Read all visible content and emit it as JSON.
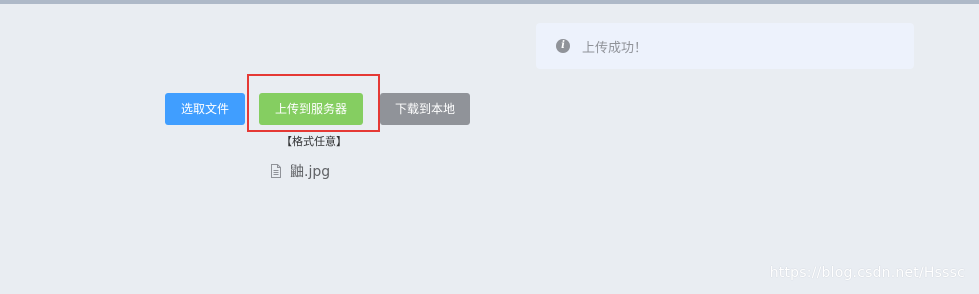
{
  "alert": {
    "icon": "info-icon",
    "icon_glyph": "i",
    "message": "上传成功！"
  },
  "buttons": {
    "select_label": "选取文件",
    "upload_label": "上传到服务器",
    "download_label": "下载到本地"
  },
  "hint": "【格式任意】",
  "file_list": [
    {
      "icon": "document-icon",
      "name": "鼬.jpg"
    }
  ],
  "watermark": "https://blog.csdn.net/Hsssc",
  "colors": {
    "primary": "#409eff",
    "success": "#85ce61",
    "info": "#909399",
    "highlight": "#e53935",
    "background": "#e9edf2"
  }
}
